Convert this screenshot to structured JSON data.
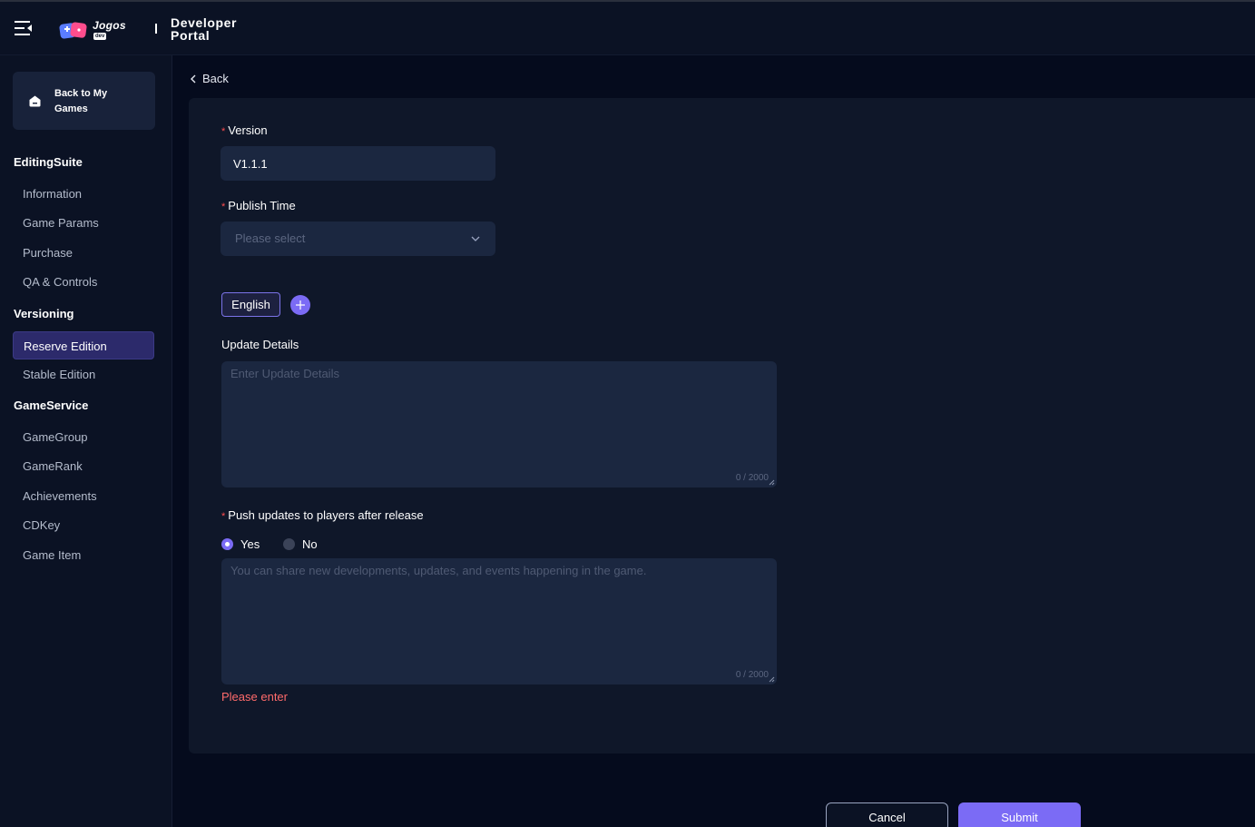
{
  "header": {
    "brand": "Jogos",
    "brand_badge": "dev",
    "portal_title": "Developer Portal"
  },
  "sidebar": {
    "back_label": "Back to My Games",
    "sections": [
      {
        "title": "EditingSuite",
        "items": [
          "Information",
          "Game Params",
          "Purchase",
          "QA & Controls"
        ]
      },
      {
        "title": "Versioning",
        "items": [
          "Reserve Edition",
          "Stable Edition"
        ]
      },
      {
        "title": "GameService",
        "items": [
          "GameGroup",
          "GameRank",
          "Achievements",
          "CDKey",
          "Game Item"
        ]
      }
    ],
    "active_item": "Reserve Edition"
  },
  "main": {
    "back_label": "Back",
    "version": {
      "label": "Version",
      "value": "V1.1.1"
    },
    "publish_time": {
      "label": "Publish Time",
      "placeholder": "Please select"
    },
    "language_tab": "English",
    "update_details": {
      "label": "Update Details",
      "placeholder": "Enter Update Details",
      "counter": "0 / 2000"
    },
    "push_updates": {
      "label": "Push updates to players after release",
      "options": [
        "Yes",
        "No"
      ],
      "selected": "Yes",
      "placeholder": "You can share new developments, updates, and events happening in the game.",
      "counter": "0 / 2000",
      "error": "Please enter"
    },
    "buttons": {
      "cancel": "Cancel",
      "submit": "Submit"
    }
  },
  "colors": {
    "accent": "#7b6bf5",
    "error": "#ff6b6b",
    "required": "#ff4d4f"
  }
}
